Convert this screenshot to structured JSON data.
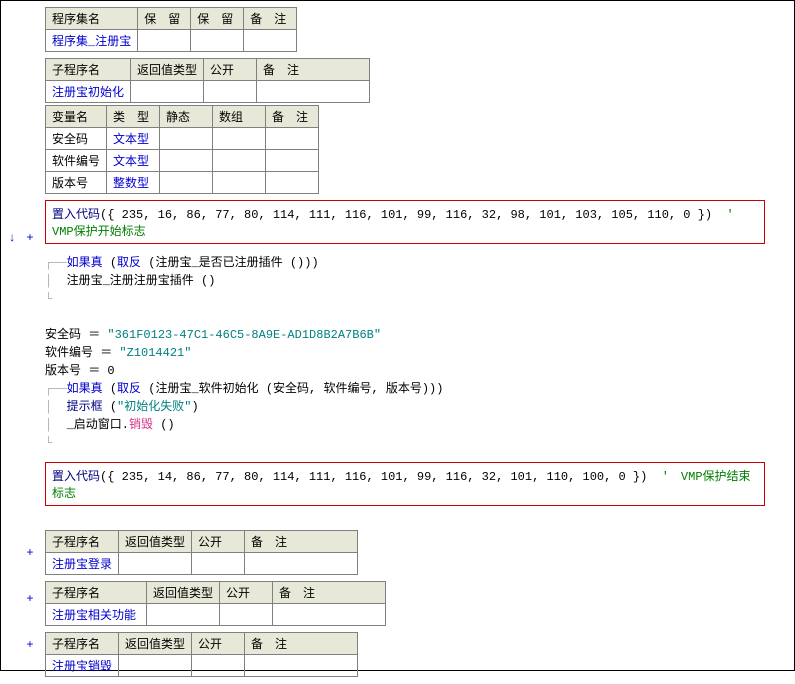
{
  "table1": {
    "headers": [
      "程序集名",
      "保　留",
      "保　留",
      "备　注"
    ],
    "row": "程序集_注册宝"
  },
  "table2": {
    "headers": [
      "子程序名",
      "返回值类型",
      "公开",
      "备　注"
    ],
    "row": "注册宝初始化"
  },
  "table3": {
    "headers": [
      "变量名",
      "类　型",
      "静态",
      "数组",
      "备　注"
    ],
    "rows": [
      {
        "name": "安全码",
        "type": "文本型"
      },
      {
        "name": "软件编号",
        "type": "文本型"
      },
      {
        "name": "版本号",
        "type": "整数型"
      }
    ]
  },
  "codebox1": {
    "func": "置入代码",
    "args": "({ 235, 16, 86, 77, 80, 114, 111, 116, 101, 99, 116, 32, 98, 101, 103, 105, 110, 0 })",
    "comment": "'　VMP保护开始标志"
  },
  "codeblock": {
    "l1a": "如果真",
    "l1b": " (",
    "l1c": "取反",
    "l1d": " (注册宝_是否已注册插件 ()))",
    "l2": "注册宝_注册注册宝插件 ()",
    "l3a": "安全码 ＝ ",
    "l3b": "\"361F0123-47C1-46C5-8A9E-AD1D8B2A7B6B\"",
    "l4a": "软件编号 ＝ ",
    "l4b": "\"Z1014421\"",
    "l5a": "版本号 ＝ ",
    "l5b": "0",
    "l6a": "如果真",
    "l6b": " (",
    "l6c": "取反",
    "l6d": " (注册宝_软件初始化 (安全码, 软件编号, 版本号)))",
    "l7a": "提示框",
    "l7b": " (",
    "l7c": "\"初始化失败\"",
    "l7d": ")",
    "l8a": "_启动窗口.",
    "l8b": "销毁",
    "l8c": " ()"
  },
  "codebox2": {
    "func": "置入代码",
    "args": "({ 235, 14, 86, 77, 80, 114, 111, 116, 101, 99, 116, 32, 101, 110, 100, 0 })",
    "comment": "'　VMP保护结束标志"
  },
  "table4": {
    "headers": [
      "子程序名",
      "返回值类型",
      "公开",
      "备　注"
    ],
    "row": "注册宝登录"
  },
  "table5": {
    "headers": [
      "子程序名",
      "返回值类型",
      "公开",
      "备　注"
    ],
    "row": "注册宝相关功能"
  },
  "table6": {
    "headers": [
      "子程序名",
      "返回值类型",
      "公开",
      "备　注"
    ],
    "row": "注册宝销毁"
  },
  "gutter": {
    "arrow": "↓",
    "plus": "+"
  }
}
